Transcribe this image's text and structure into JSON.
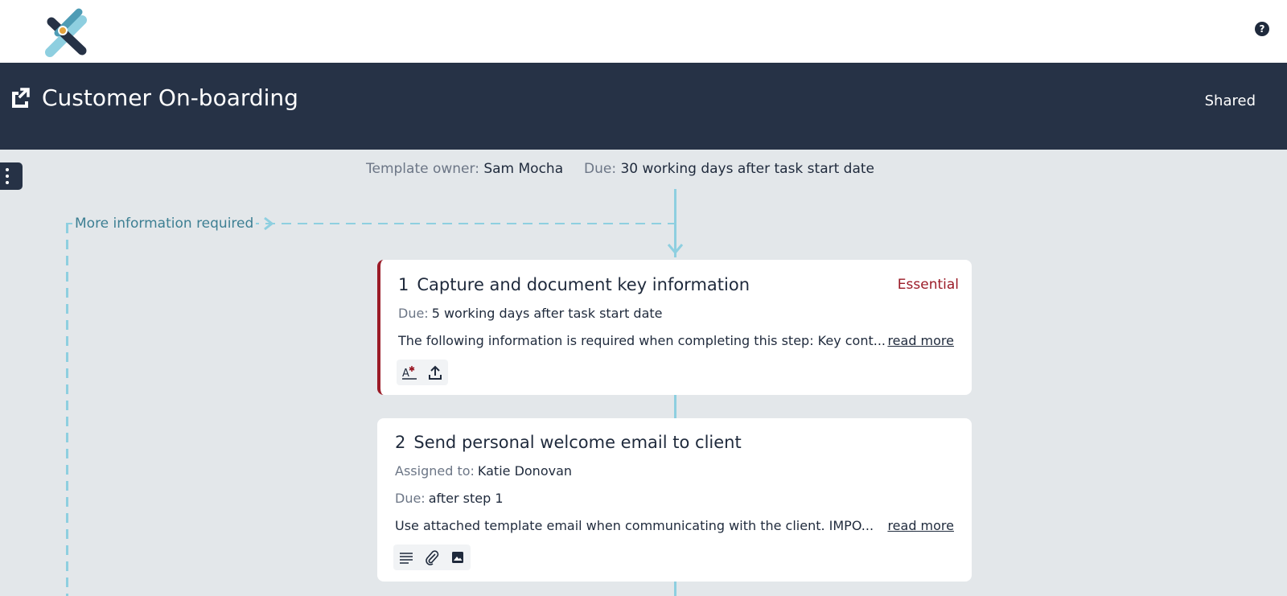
{
  "app": {
    "help_icon": "?"
  },
  "header": {
    "title": "Customer On-boarding",
    "status": "Shared",
    "icon": "open-external-icon"
  },
  "meta": {
    "owner_label": "Template owner:",
    "owner_value": "Sam Mocha",
    "due_label": "Due:",
    "due_value": "30 working days after task start date"
  },
  "flow": {
    "loop_label": "More information required"
  },
  "steps": [
    {
      "number": "1",
      "title": "Capture and document key information",
      "badge": "Essential",
      "due_label": "Due:",
      "due_value": "5 working days after task start date",
      "description": "The following information is required when completing this step: Key cont...",
      "read_more": "read more",
      "tools": [
        "form-field-icon",
        "upload-icon"
      ]
    },
    {
      "number": "2",
      "title": "Send personal welcome email to client",
      "assigned_label": "Assigned to:",
      "assigned_value": "Katie Donovan",
      "due_label": "Due:",
      "due_value": "after step 1",
      "description": "Use attached template email when communicating with the client. IMPO...",
      "read_more": "read more",
      "tools": [
        "text-icon",
        "attachment-icon",
        "image-icon"
      ]
    }
  ],
  "colors": {
    "navy": "#263246",
    "background": "#e3e7ea",
    "flow": "#8ecfe0",
    "essential": "#9b1b27",
    "link_teal": "#3d7f93"
  }
}
